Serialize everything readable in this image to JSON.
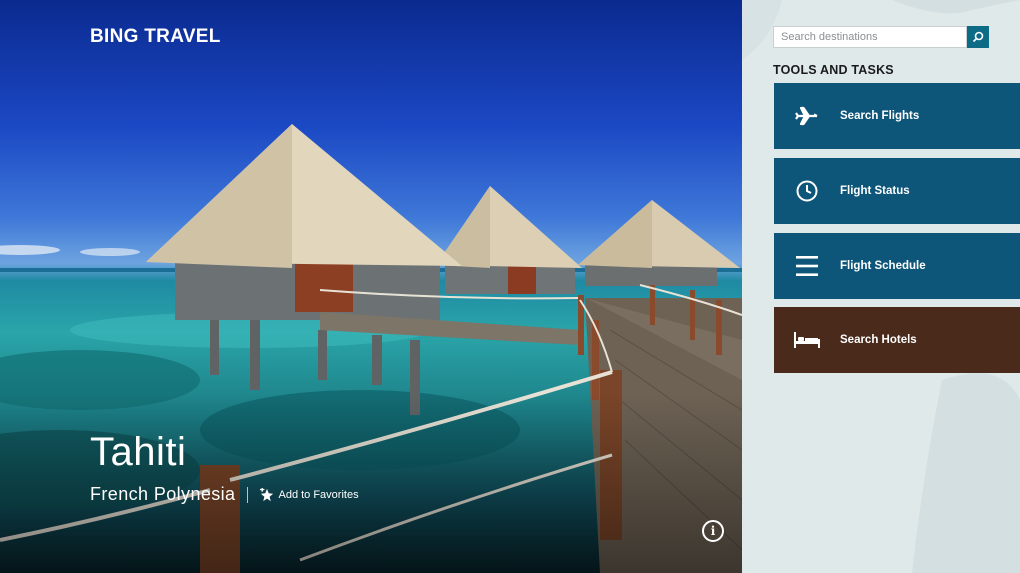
{
  "app": {
    "title": "BING TRAVEL"
  },
  "destination": {
    "name": "Tahiti",
    "region": "French Polynesia",
    "favorite_label": "Add to Favorites"
  },
  "search": {
    "placeholder": "Search destinations"
  },
  "tools": {
    "heading": "TOOLS AND TASKS",
    "items": [
      {
        "label": "Search Flights",
        "icon": "airplane-icon",
        "color": "#0e5679"
      },
      {
        "label": "Flight Status",
        "icon": "clock-icon",
        "color": "#0e5679"
      },
      {
        "label": "Flight Schedule",
        "icon": "list-icon",
        "color": "#0e5679"
      },
      {
        "label": "Search Hotels",
        "icon": "bed-icon",
        "color": "#4a2a1a"
      }
    ]
  },
  "colors": {
    "tile_blue": "#0e5679",
    "tile_brown": "#4a2a1a",
    "panel_bg": "#dfe9ea",
    "search_button": "#0d6b86"
  },
  "info_glyph": "i"
}
